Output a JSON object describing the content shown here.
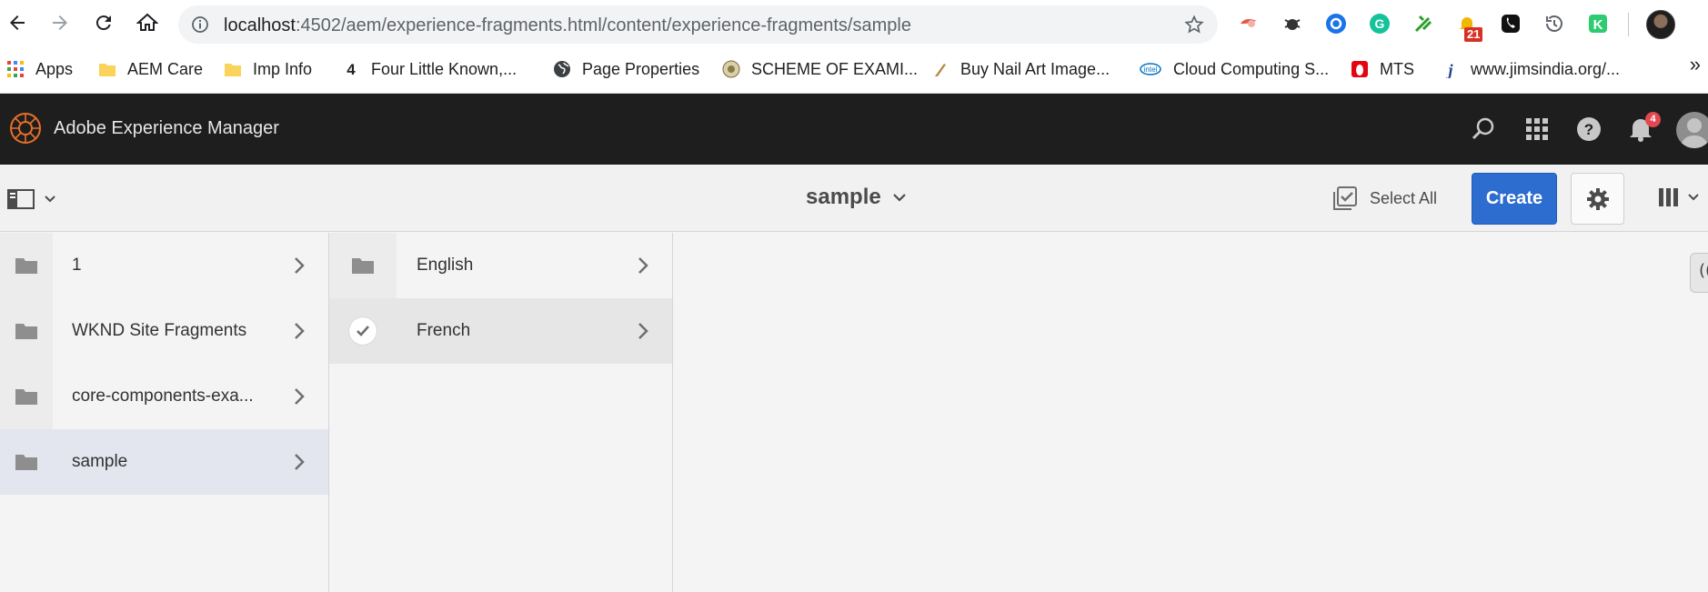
{
  "browser": {
    "url_host": "localhost",
    "url_rest": ":4502/aem/experience-fragments.html/content/experience-fragments/sample",
    "extension_badge": "21",
    "bookmarks": [
      {
        "label": "Apps",
        "icon": "apps-grid-icon"
      },
      {
        "label": "AEM Care",
        "icon": "folder-icon"
      },
      {
        "label": "Imp Info",
        "icon": "folder-icon"
      },
      {
        "label": "Four Little Known,...",
        "icon": "site-favicon"
      },
      {
        "label": "Page Properties",
        "icon": "globe-icon"
      },
      {
        "label": "SCHEME OF EXAMI...",
        "icon": "site-favicon"
      },
      {
        "label": "Buy Nail Art Image...",
        "icon": "site-favicon"
      },
      {
        "label": "Cloud Computing S...",
        "icon": "intel-favicon"
      },
      {
        "label": "MTS",
        "icon": "site-favicon"
      },
      {
        "label": "www.jimsindia.org/...",
        "icon": "site-favicon"
      }
    ],
    "more_bookmarks": "»"
  },
  "shell": {
    "title": "Adobe Experience Manager",
    "notification_count": "4"
  },
  "actionbar": {
    "breadcrumb": "sample",
    "select_all_label": "Select All",
    "create_label": "Create"
  },
  "columns": {
    "col1": [
      {
        "label": "1",
        "state": "normal"
      },
      {
        "label": "WKND Site Fragments",
        "state": "normal"
      },
      {
        "label": "core-components-exa...",
        "state": "normal"
      },
      {
        "label": "sample",
        "state": "active"
      }
    ],
    "col2": [
      {
        "label": "English",
        "state": "normal"
      },
      {
        "label": "French",
        "state": "selected"
      }
    ]
  },
  "side_tab": "(("
}
